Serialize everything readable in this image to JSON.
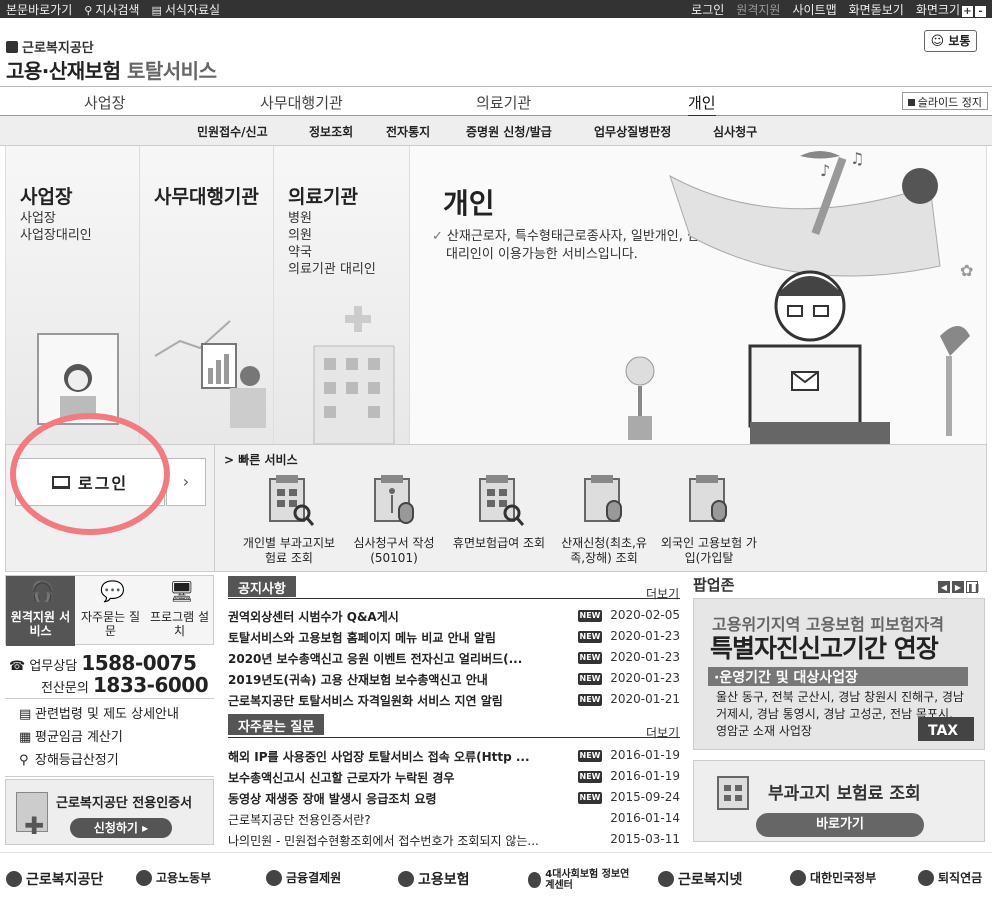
{
  "topbar": {
    "left_links": [
      "본문바로가기",
      "지사검색",
      "서식자료실"
    ],
    "right_links": [
      "로그인",
      "원격지원",
      "사이트맵",
      "화면돋보기"
    ],
    "font_size_label": "화면크기",
    "plus": "+",
    "minus": "-"
  },
  "header": {
    "org": "근로복지공단",
    "title": "고용·산재보험",
    "title_sub": "토탈서비스",
    "normal_button": "보통"
  },
  "main_nav": {
    "items": [
      "사업장",
      "사무대행기관",
      "의료기관",
      "개인"
    ],
    "active": "개인",
    "slide_stop": "슬라이드 정지"
  },
  "sub_nav": {
    "items": [
      "민원접수/신고",
      "정보조회",
      "전자통지",
      "증명원 신청/발급",
      "업무상질병판정",
      "심사청구"
    ]
  },
  "hero": {
    "columns": [
      {
        "title": "사업장",
        "items": [
          "사업장",
          "사업장대리인"
        ]
      },
      {
        "title": "사무대행기관",
        "items": []
      },
      {
        "title": "의료기관",
        "items": [
          "병원",
          "의원",
          "약국",
          "의료기관 대리인"
        ]
      }
    ],
    "individual": {
      "title": "개인",
      "desc": "산재근로자, 특수형태근로종사자, 일반개인, 심사청구 대리인이 이용가능한 서비스입니다."
    }
  },
  "quick": {
    "login": "로그인",
    "title": "빠른 서비스",
    "services": [
      "개인별 부과고지보험료 조회",
      "심사청구서 작성(50101)",
      "휴면보험급여 조회",
      "산재신청(최초,유족,장해) 조회",
      "외국인 고용보험 가입(가입탈"
    ]
  },
  "left": {
    "tiles": [
      "원격지원 서비스",
      "자주묻는 질문",
      "프로그램 설치"
    ],
    "phone1_label": "업무상담",
    "phone1": "1588-0075",
    "phone2_label": "전산문의",
    "phone2": "1833-6000",
    "links": [
      "관련법령 및 제도 상세안내",
      "평균임금 계산기",
      "장해등급산정기"
    ],
    "cert_title": "근로복지공단 전용인증서",
    "cert_button": "신청하기"
  },
  "notices": {
    "title": "공지사항",
    "more": "더보기",
    "rows": [
      {
        "title": "권역외상센터 시범수가 Q&A게시",
        "new": "NEW",
        "date": "2020-02-05"
      },
      {
        "title": "토탈서비스와 고용보험 홈페이지 메뉴 비교 안내 알림",
        "new": "NEW",
        "date": "2020-01-23"
      },
      {
        "title": "2020년 보수총액신고 응원 이벤트 전자신고 얼리버드(...",
        "new": "NEW",
        "date": "2020-01-23"
      },
      {
        "title": "2019년도(귀속) 고용 산재보험 보수총액신고 안내",
        "new": "NEW",
        "date": "2020-01-23"
      },
      {
        "title": "근로복지공단 토탈서비스 자격일원화 서비스 지연 알림",
        "new": "NEW",
        "date": "2020-01-21"
      }
    ]
  },
  "faq": {
    "title": "자주묻는 질문",
    "more": "더보기",
    "rows": [
      {
        "title": "해외 IP를 사용중인 사업장 토탈서비스 접속 오류(Http ...",
        "new": "NEW",
        "date": "2016-01-19"
      },
      {
        "title": "보수총액신고시 신고할 근로자가 누락된 경우",
        "new": "NEW",
        "date": "2016-01-19"
      },
      {
        "title": "동영상 재생중 장애 발생시 응급조치 요령",
        "new": "NEW",
        "date": "2015-09-24"
      },
      {
        "title": "근로복지공단 전용인증서란?",
        "new": "",
        "date": "2016-01-14"
      },
      {
        "title": "나의민원 - 민원접수현황조회에서 접수번호가 조회되지 않는...",
        "new": "",
        "date": "2015-03-11"
      }
    ]
  },
  "popup": {
    "title": "팝업존",
    "banner_line1": "고용위기지역",
    "banner_line1b": "고용보험 피보험자격",
    "banner_line2": "특별자진신고기간 연장",
    "banner_line3": "·운영기간 및 대상사업장",
    "banner_line4": "울산 동구, 전북 군산시, 경남 창원시 진해구, 경남 거제시, 경남 통영시, 경남 고성군, 전남 목포시, 영암군 소재 사업장",
    "tax": "TAX",
    "bill_title": "부과고지 보험료 조회",
    "bill_button": "바로가기"
  },
  "footer": {
    "logos": [
      "근로복지공단",
      "고용노동부",
      "금융결제원",
      "고용보험",
      "4대사회보험 정보연계센터",
      "근로복지넷",
      "대한민국정부",
      "퇴직연금"
    ]
  }
}
